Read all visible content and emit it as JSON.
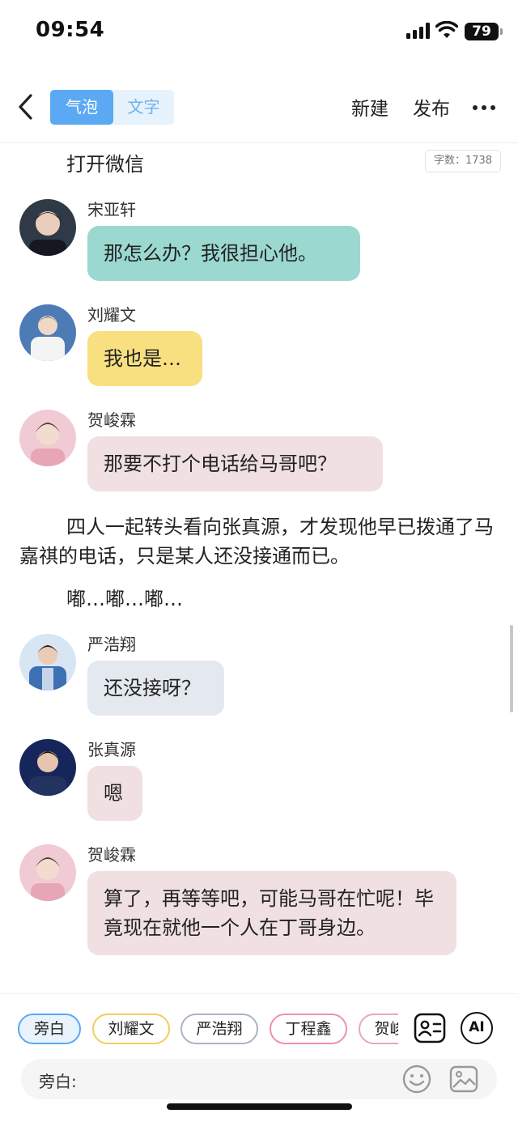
{
  "status_bar": {
    "time": "09:54",
    "battery": "79"
  },
  "nav": {
    "tab_bubble": "气泡",
    "tab_text": "文字",
    "new_label": "新建",
    "publish_label": "发布",
    "icons": {
      "back": "chevron-left-icon",
      "more": "more-dots-icon"
    }
  },
  "word_count": "字数：1738",
  "messages": [
    {
      "type": "narration",
      "text": "打开微信"
    },
    {
      "type": "bubble",
      "name": "宋亚轩",
      "text": "那怎么办？我很担心他。",
      "color": "#9bd9d0"
    },
    {
      "type": "bubble",
      "name": "刘耀文",
      "text": "我也是…",
      "color": "#f8df80"
    },
    {
      "type": "bubble",
      "name": "贺峻霖",
      "text": "那要不打个电话给马哥吧？",
      "color": "#f0e0e1"
    },
    {
      "type": "narration",
      "text": "四人一起转头看向张真源，才发现他早已拨通了马嘉祺的电话，只是某人还没接通而已。"
    },
    {
      "type": "narration",
      "text": "嘟…嘟…嘟…"
    },
    {
      "type": "bubble",
      "name": "严浩翔",
      "text": "还没接呀？",
      "color": "#e4e8ef"
    },
    {
      "type": "bubble",
      "name": "张真源",
      "text": "嗯",
      "color": "#f0e0e1"
    },
    {
      "type": "bubble",
      "name": "贺峻霖",
      "text": "算了，再等等吧，可能马哥在忙呢！毕竟现在就他一个人在丁哥身边。",
      "color": "#f0e0e1"
    }
  ],
  "bottom": {
    "chips": [
      {
        "label": "旁白",
        "border": "#5aa9f2",
        "fill": "#e9f3fd"
      },
      {
        "label": "刘耀文",
        "border": "#f2cd5c",
        "fill": "#ffffff"
      },
      {
        "label": "严浩翔",
        "border": "#a9b4c6",
        "fill": "#ffffff"
      },
      {
        "label": "丁程鑫",
        "border": "#ef8fb0",
        "fill": "#ffffff"
      },
      {
        "label": "贺峻霖",
        "border": "#e9a7b5",
        "fill": "#ffffff"
      }
    ],
    "input_label": "旁白:",
    "ai_label": "AI",
    "icons": {
      "contact": "contact-card-icon",
      "ai": "ai-icon",
      "emoji": "emoji-icon",
      "image": "image-icon"
    }
  }
}
